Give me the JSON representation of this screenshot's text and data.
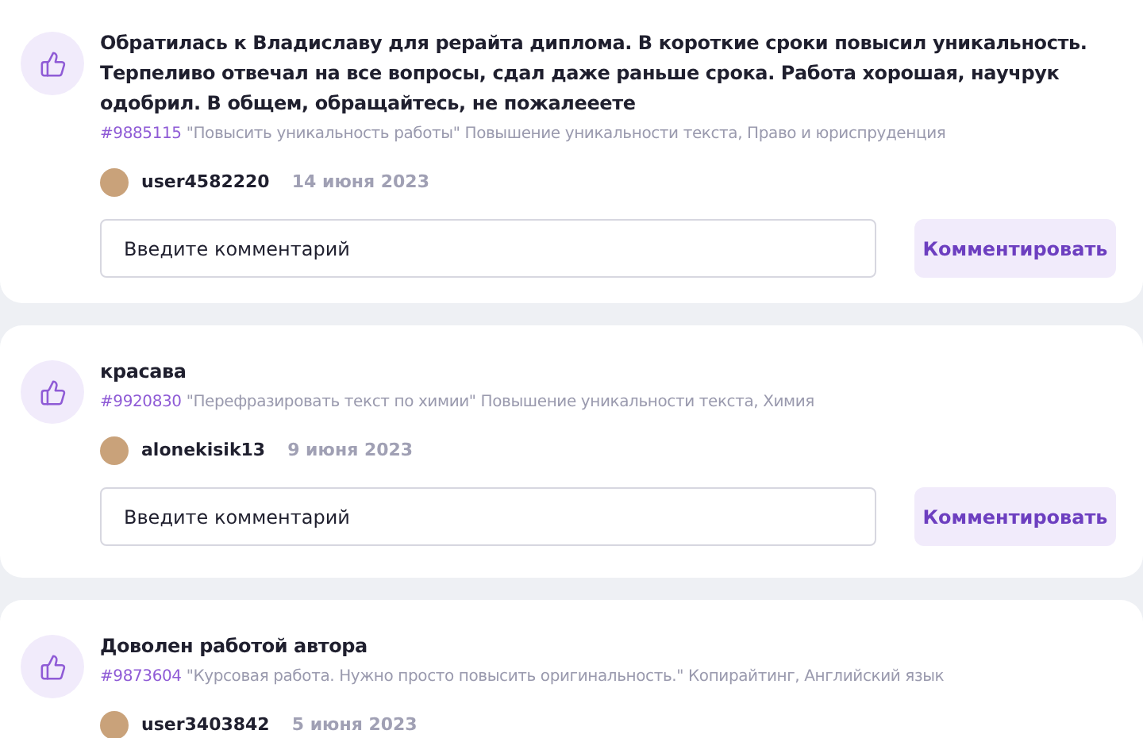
{
  "reviews": [
    {
      "text": "Обратилась к Владиславу для рерайта диплома. В короткие сроки повысил уникальность. Терпеливо отвечал на все вопросы, сдал даже раньше срока. Работа хорошая, научрук одобрил. В общем, обращайтесь, не пожалееете",
      "order_id": "#9885115",
      "order_info": "\"Повысить уникальность работы\" Повышение уникальности текста, Право и юриспруденция",
      "user": "user4582220",
      "date": "14 июня 2023",
      "comment": {
        "placeholder": "Введите комментарий",
        "button": "Комментировать"
      }
    },
    {
      "text": "красава",
      "order_id": "#9920830",
      "order_info": "\"Перефразировать текст по химии\" Повышение уникальности текста, Химия",
      "user": "alonekisik13",
      "date": "9 июня 2023",
      "comment": {
        "placeholder": "Введите комментарий",
        "button": "Комментировать"
      }
    },
    {
      "text": "Доволен работой автора",
      "order_id": "#9873604",
      "order_info": "\"Курсовая работа. Нужно просто повысить оригинальность.\" Копирайтинг, Английский язык",
      "user": "user3403842",
      "date": "5 июня 2023"
    }
  ]
}
